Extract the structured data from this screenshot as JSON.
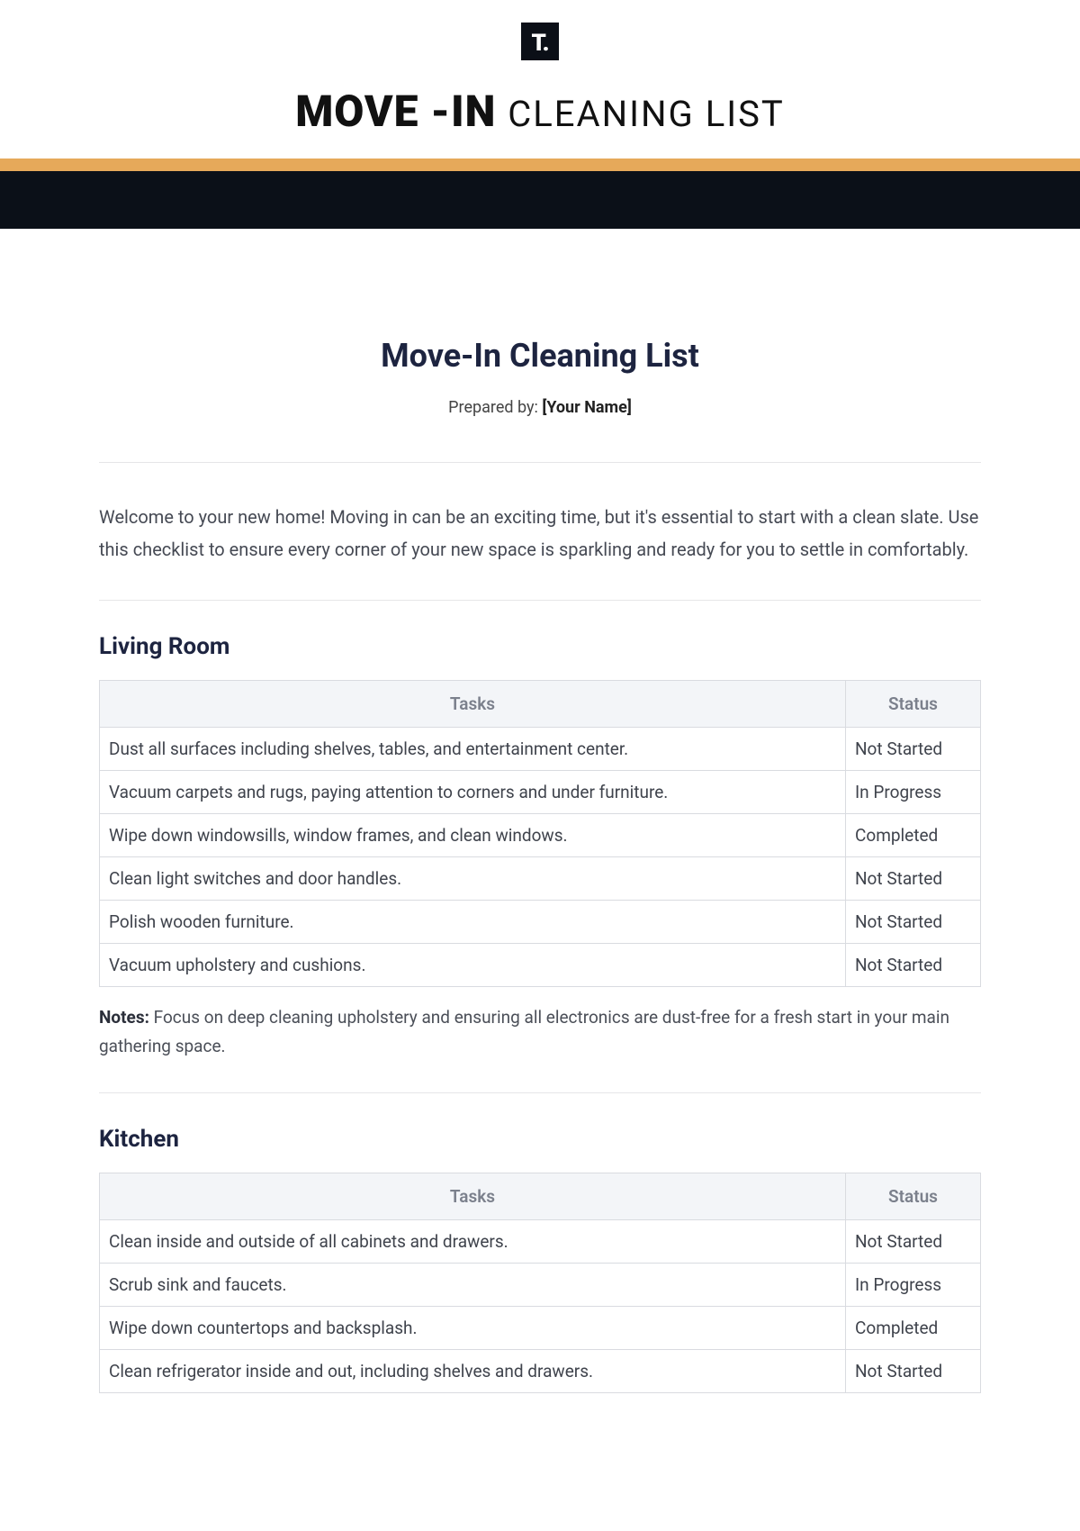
{
  "logo_text": "T.",
  "banner": {
    "bold": "MOVE -IN",
    "light": "CLEANING LIST"
  },
  "doc_title": "Move-In Cleaning List",
  "prepared_label": "Prepared by: ",
  "prepared_name": "[Your Name]",
  "intro": "Welcome to your new home! Moving in can be an exciting time, but it's essential to start with a clean slate. Use this checklist to ensure every corner of your new space is sparkling and ready for you to settle in comfortably.",
  "columns": {
    "tasks": "Tasks",
    "status": "Status"
  },
  "notes_label": "Notes:",
  "sections": [
    {
      "title": "Living Room",
      "rows": [
        {
          "task": "Dust all surfaces including shelves, tables, and entertainment center.",
          "status": "Not Started"
        },
        {
          "task": "Vacuum carpets and rugs, paying attention to corners and under furniture.",
          "status": "In Progress"
        },
        {
          "task": "Wipe down windowsills, window frames, and clean windows.",
          "status": "Completed"
        },
        {
          "task": "Clean light switches and door handles.",
          "status": "Not Started"
        },
        {
          "task": "Polish wooden furniture.",
          "status": "Not Started"
        },
        {
          "task": "Vacuum upholstery and cushions.",
          "status": "Not Started"
        }
      ],
      "notes": " Focus on deep cleaning upholstery and ensuring all electronics are dust-free for a fresh start in your main gathering space."
    },
    {
      "title": "Kitchen",
      "rows": [
        {
          "task": "Clean inside and outside of all cabinets and drawers.",
          "status": "Not Started"
        },
        {
          "task": "Scrub sink and faucets.",
          "status": "In Progress"
        },
        {
          "task": "Wipe down countertops and backsplash.",
          "status": "Completed"
        },
        {
          "task": "Clean refrigerator inside and out, including shelves and drawers.",
          "status": "Not Started"
        }
      ],
      "notes": ""
    }
  ]
}
